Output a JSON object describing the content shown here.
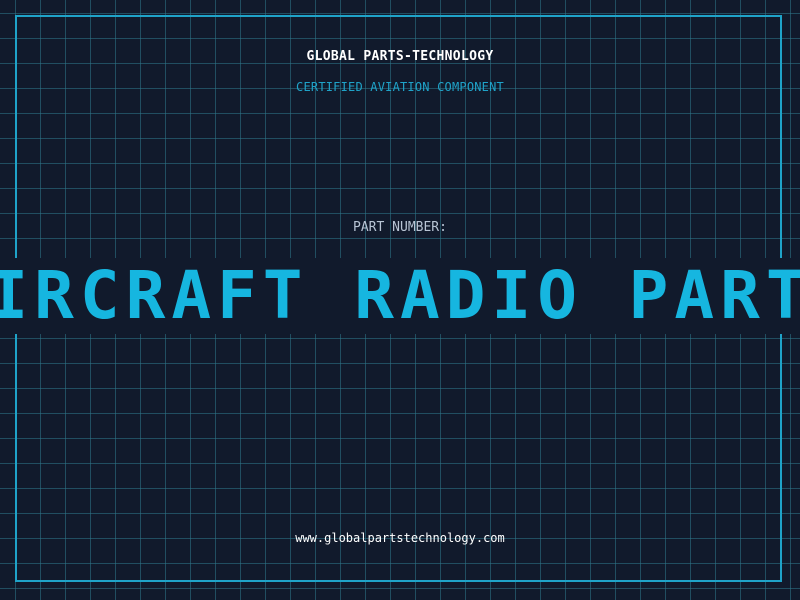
{
  "header": {
    "company": "GLOBAL PARTS-TECHNOLOGY",
    "subtitle": "CERTIFIED AVIATION COMPONENT"
  },
  "part": {
    "label": "PART NUMBER:",
    "value": "AIRCRAFT RADIO PARTS"
  },
  "footer": {
    "url": "www.globalpartstechnology.com"
  },
  "colors": {
    "background": "#111a2c",
    "accent": "#16b6e0",
    "grid": "#2e788c",
    "text": "#ffffff",
    "muted": "#b8c4d4"
  }
}
